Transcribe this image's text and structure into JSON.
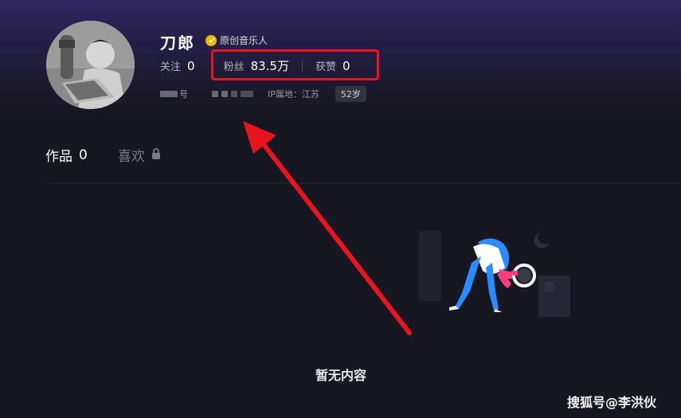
{
  "profile": {
    "name": "刀郎",
    "verified_label": "原创音乐人",
    "stats": {
      "follow_label": "关注",
      "follow_value": "0",
      "fans_label": "粉丝",
      "fans_value": "83.5万",
      "likes_label": "获赞",
      "likes_value": "0"
    },
    "meta": {
      "id_suffix": "号",
      "ip_label": "IP属地：江苏",
      "age": "52岁"
    }
  },
  "tabs": [
    {
      "label": "作品",
      "count": "0"
    },
    {
      "label": "喜欢"
    }
  ],
  "empty_state": {
    "text": "暂无内容"
  },
  "watermark": "搜狐号@李洪伙",
  "colors": {
    "background": "#171722",
    "highlight": "#e8141f",
    "verified_badge": "#f5b400",
    "illustration_blue": "#2a8cff",
    "illustration_pink": "#ff3d7f"
  }
}
